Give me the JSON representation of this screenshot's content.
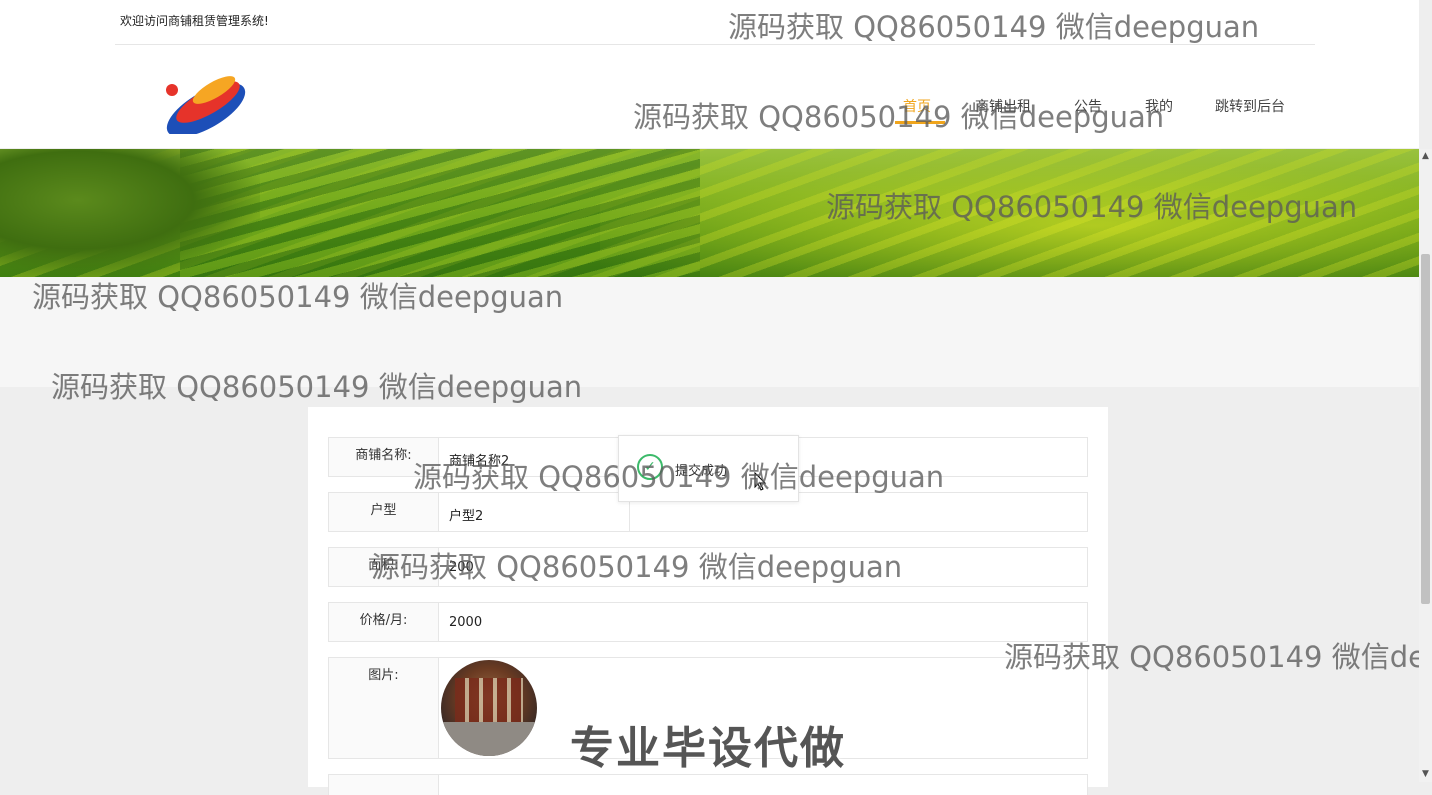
{
  "header": {
    "welcome": "欢迎访问商铺租赁管理系统!",
    "nav": [
      {
        "label": "首页"
      },
      {
        "label": "商铺出租"
      },
      {
        "label": "公告"
      },
      {
        "label": "我的"
      },
      {
        "label": "跳转到后台"
      }
    ]
  },
  "form": {
    "fields": [
      {
        "label": "商铺名称:",
        "value": "商铺名称2"
      },
      {
        "label": "户型",
        "value": "户型2"
      },
      {
        "label": "面积:",
        "value": "200"
      },
      {
        "label": "价格/月:",
        "value": "2000"
      },
      {
        "label": "图片:",
        "value": ""
      }
    ]
  },
  "toast": {
    "text": "提交成功"
  },
  "watermarks": [
    "源码获取 QQ86050149 微信deepguan",
    "专业毕设代做"
  ],
  "colors": {
    "accent": "#f0a51c",
    "success": "#3cba6a"
  }
}
